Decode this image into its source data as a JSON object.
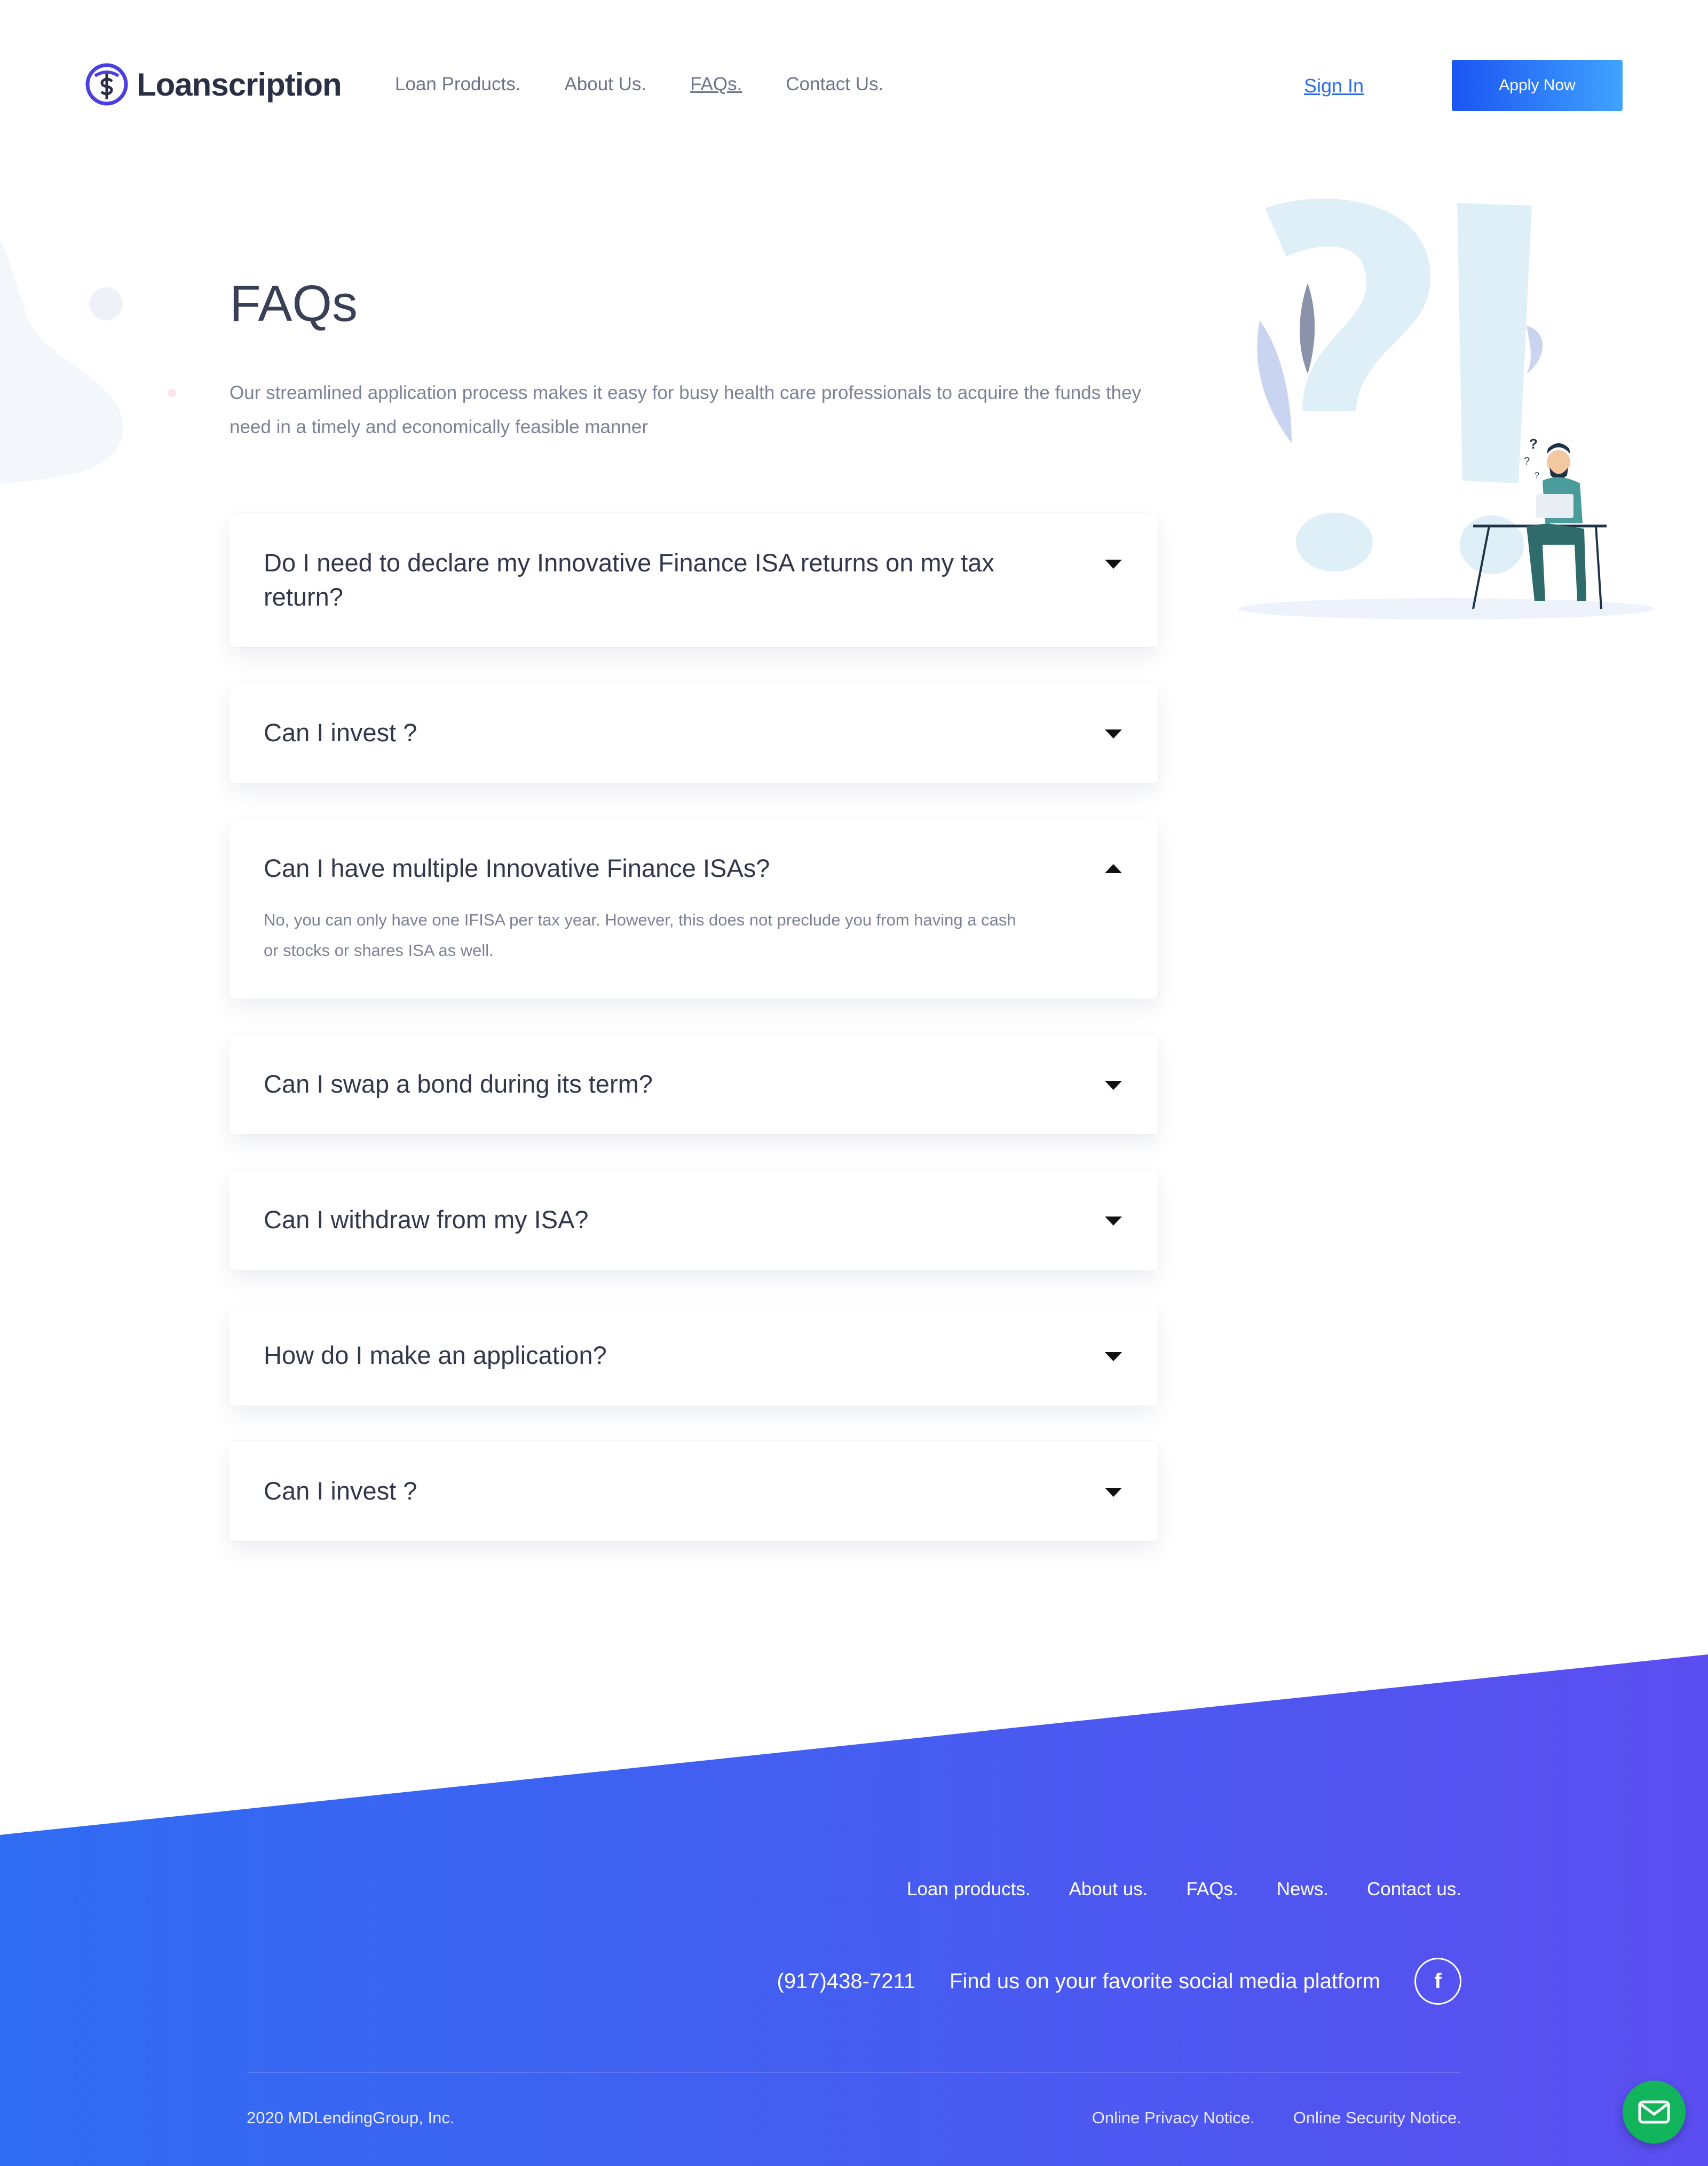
{
  "brand": {
    "name": "Loanscription"
  },
  "nav": {
    "items": [
      {
        "label": "Loan Products.",
        "active": false
      },
      {
        "label": "About Us.",
        "active": false
      },
      {
        "label": "FAQs.",
        "active": true
      },
      {
        "label": "Contact Us.",
        "active": false
      }
    ],
    "sign_in": "Sign In",
    "apply": "Apply Now"
  },
  "hero": {
    "title": "FAQs",
    "intro": "Our streamlined application process makes it easy for busy health care professionals to acquire the funds they need in a timely and economically feasible manner"
  },
  "faqs": [
    {
      "question": "Do I need to declare my Innovative Finance ISA returns on my tax return?",
      "expanded": false
    },
    {
      "question": "Can I invest ?",
      "expanded": false
    },
    {
      "question": "Can I have multiple Innovative Finance ISAs?",
      "expanded": true,
      "answer": "No, you can only have one IFISA per tax year. However, this does not preclude you from having a cash or stocks or shares ISA as well."
    },
    {
      "question": "Can I swap a bond during its term?",
      "expanded": false
    },
    {
      "question": "Can I withdraw from my ISA?",
      "expanded": false
    },
    {
      "question": "How do I make an application?",
      "expanded": false
    },
    {
      "question": "Can I invest ?",
      "expanded": false
    }
  ],
  "footer": {
    "links": [
      "Loan products.",
      "About us.",
      "FAQs.",
      "News.",
      "Contact us."
    ],
    "phone": "(917)438-7211",
    "social_text": "Find us on your favorite social media platform",
    "social_icon": "facebook-icon",
    "copyright": "2020 MDLendingGroup, Inc.",
    "legal": [
      "Online Privacy Notice.",
      "Online Security Notice."
    ]
  },
  "colors": {
    "accent": "#1b54f3",
    "footer_gradient_start": "#2f6cf2",
    "footer_gradient_end": "#5b4ef0",
    "chat": "#13b55c"
  }
}
